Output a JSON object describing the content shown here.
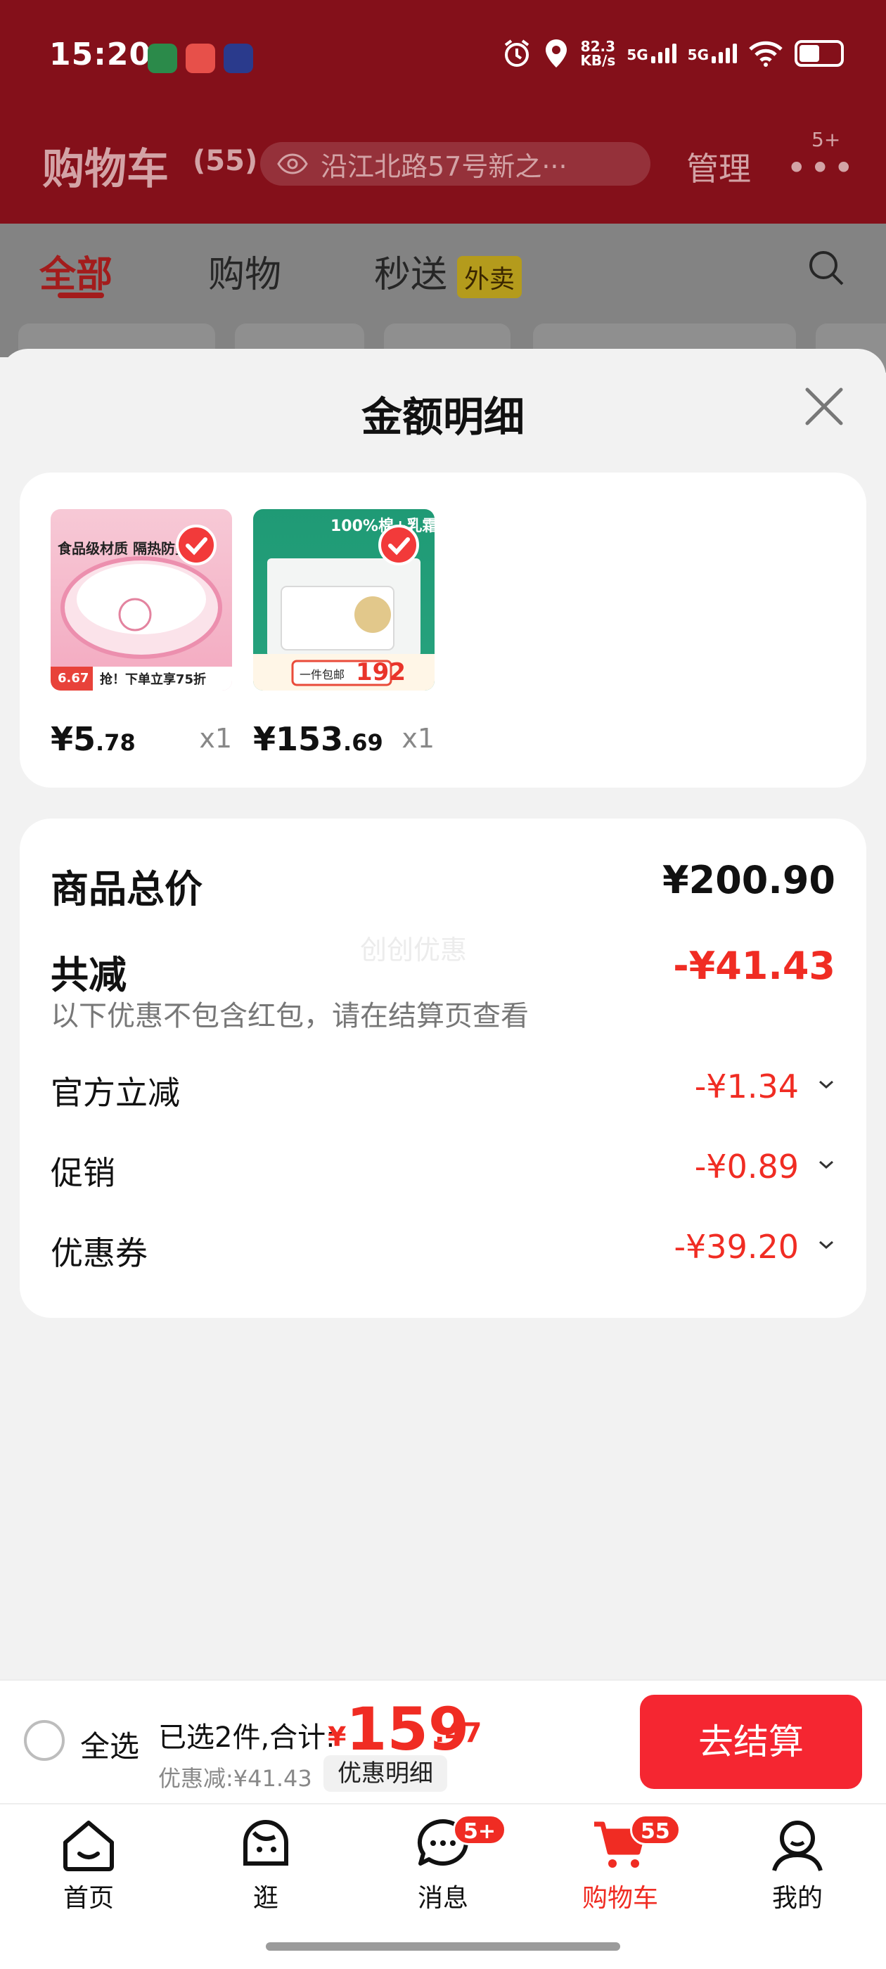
{
  "status_bar": {
    "time": "15:20",
    "net_speed_value": "82.3",
    "net_speed_unit": "KB/s",
    "sim1": "5G",
    "sim2": "5G"
  },
  "header": {
    "title": "购物车",
    "count": "(55)",
    "address": "沿江北路57号新之···",
    "manage": "管理",
    "more_badge": "5+"
  },
  "tabs": [
    {
      "label": "全部"
    },
    {
      "label": "购物"
    },
    {
      "label": "秒送",
      "badge": "外卖"
    }
  ],
  "sheet": {
    "title": "金额明细",
    "products": [
      {
        "price_int": "¥5",
        "price_dec": ".78",
        "qty": "x1",
        "thumb_text": "食品级材质 隔热防烫",
        "thumb_sub": "抢！下单立享75折",
        "thumb_tag": "6.67"
      },
      {
        "price_int": "¥153",
        "price_dec": ".69",
        "qty": "x1",
        "thumb_text": "100%棉+乳霜",
        "thumb_sub": "一件包邮",
        "thumb_tag": "192"
      }
    ],
    "summary": {
      "total_label": "商品总价",
      "total_value": "¥200.90",
      "reduce_label": "共减",
      "reduce_value": "-¥41.43",
      "watermark": "创创优惠",
      "note": "以下优惠不包含红包，请在结算页查看",
      "items": [
        {
          "label": "官方立减",
          "value": "-¥1.34"
        },
        {
          "label": "促销",
          "value": "-¥0.89"
        },
        {
          "label": "优惠券",
          "value": "-¥39.20"
        }
      ]
    }
  },
  "checkout": {
    "select_all": "全选",
    "selected_text": "已选2件,合计:",
    "currency": "¥",
    "total_int": "159",
    "total_dec": ".47",
    "discount_text": "优惠减:¥41.43",
    "discount_button": "优惠明细",
    "pay_button": "去结算"
  },
  "tabbar": [
    {
      "label": "首页",
      "icon": "home-icon"
    },
    {
      "label": "逛",
      "icon": "browse-icon"
    },
    {
      "label": "消息",
      "icon": "message-icon",
      "badge": "5+"
    },
    {
      "label": "购物车",
      "icon": "cart-icon",
      "badge": "55"
    },
    {
      "label": "我的",
      "icon": "profile-icon"
    }
  ],
  "colors": {
    "brand_red": "#f02c23",
    "pay_button": "#f52631",
    "header_bg_dimmed": "#84101a"
  }
}
